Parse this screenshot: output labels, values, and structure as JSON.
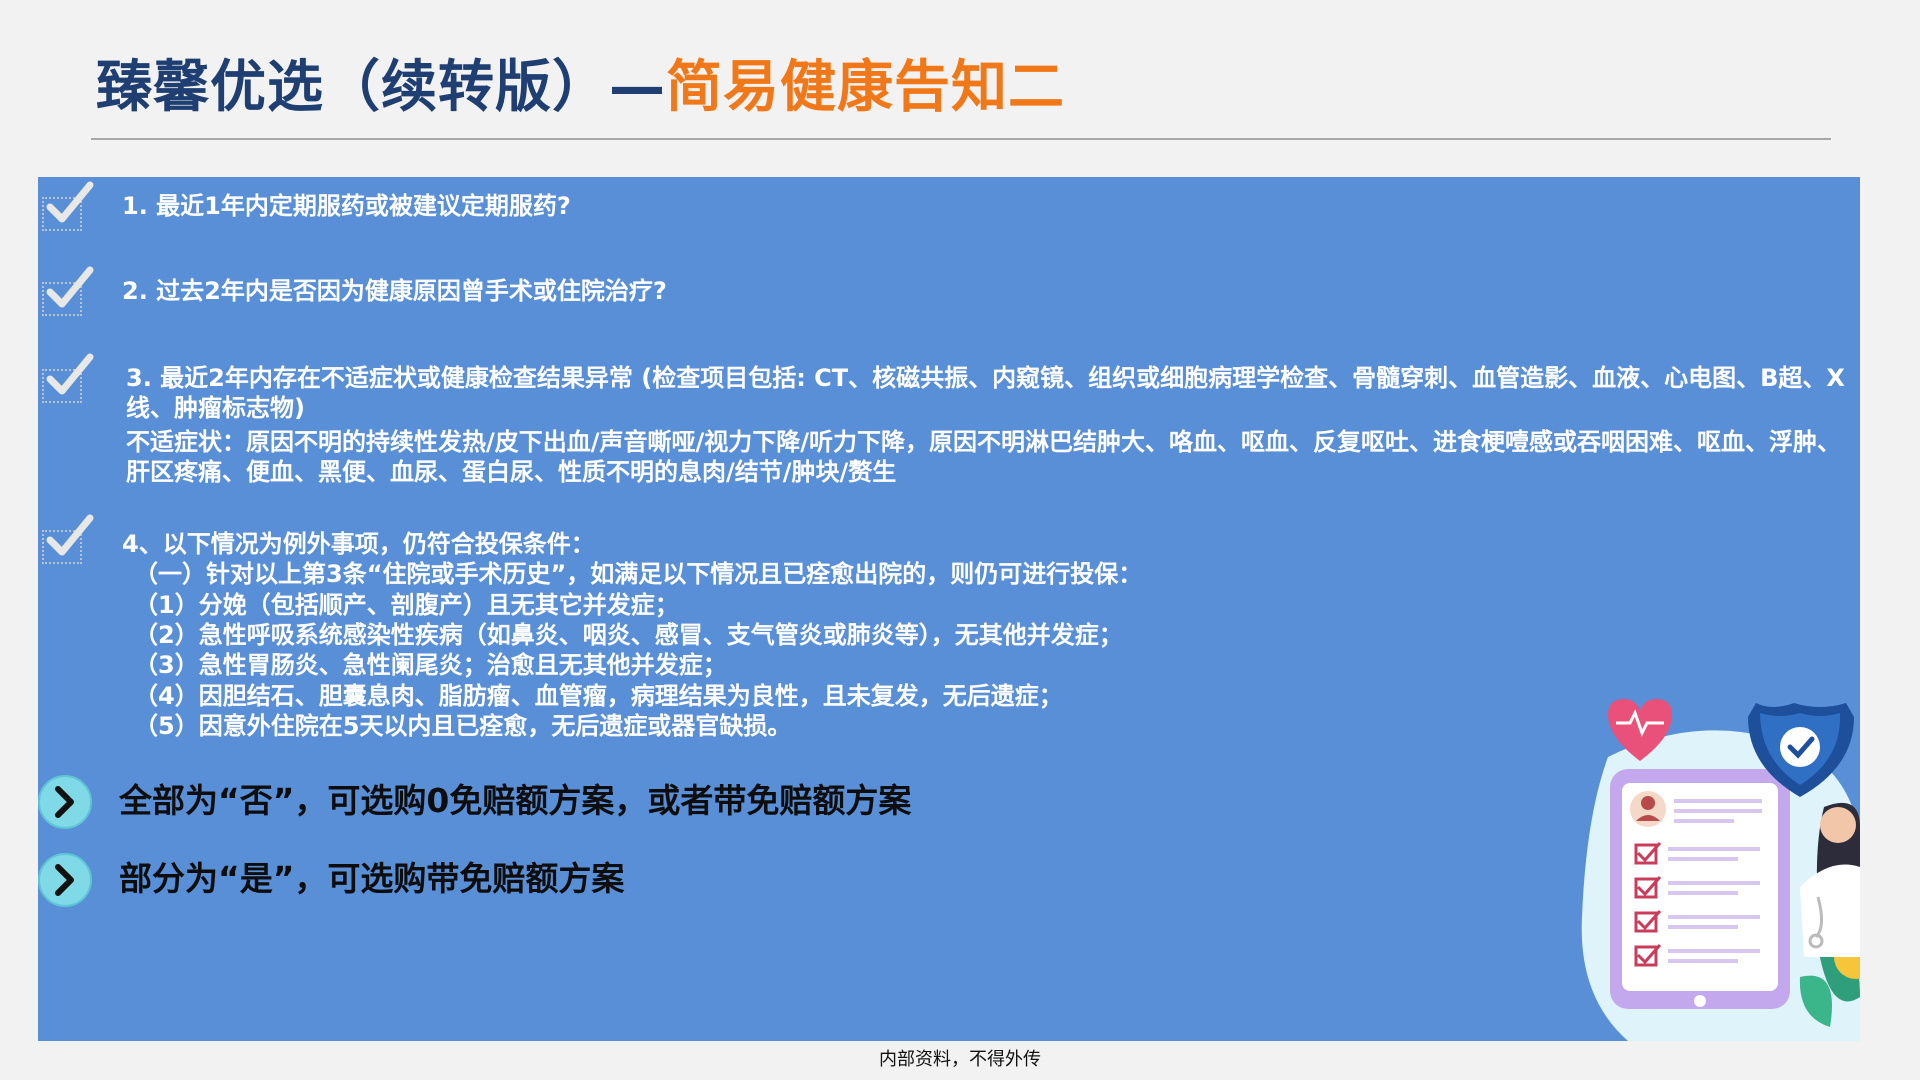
{
  "header": {
    "title_main": "臻馨优选（续转版）—",
    "title_accent": "简易健康告知二"
  },
  "questions": [
    "1. 最近1年内定期服药或被建议定期服药?",
    "2. 过去2年内是否因为健康原因曾手术或住院治疗?",
    {
      "line1": "3. 最近2年内存在不适症状或健康检查结果异常 (检查项目包括: CT、核磁共振、内窥镜、组织或细胞病理学检查、骨髓穿刺、血管造影、血液、心电图、B超、X线、肿瘤标志物)",
      "line2": "不适症状：原因不明的持续性发热/皮下出血/声音嘶哑/视力下降/听力下降，原因不明淋巴结肿大、咯血、呕血、反复呕吐、进食梗噎感或吞咽困难、呕血、浮肿、肝区疼痛、便血、黑便、血尿、蛋白尿、性质不明的息肉/结节/肿块/赘生"
    },
    {
      "lines": [
        "4、以下情况为例外事项，仍符合投保条件：",
        "（一）针对以上第3条“住院或手术历史”，如满足以下情况且已痊愈出院的，则仍可进行投保：",
        "（1）分娩（包括顺产、剖腹产）且无其它并发症；",
        "（2）急性呼吸系统感染性疾病（如鼻炎、咽炎、感冒、支气管炎或肺炎等），无其他并发症；",
        "（3）急性胃肠炎、急性阑尾炎；治愈且无其他并发症；",
        "（4）因胆结石、胆囊息肉、脂肪瘤、血管瘤，病理结果为良性，且未复发，无后遗症；",
        "（5）因意外住院在5天以内且已痊愈，无后遗症或器官缺损。"
      ]
    }
  ],
  "conclusions": [
    "全部为“否”，可选购0免赔额方案，或者带免赔额方案",
    "部分为“是”，可选购带免赔额方案"
  ],
  "footer": "内部资料，不得外传",
  "colors": {
    "panel": "#598fd6",
    "title_main": "#1f3f73",
    "title_accent": "#f07818",
    "arrow_circle": "#7fd9e6"
  },
  "icons": [
    "check-icon",
    "chevron-right-icon",
    "heart-pulse-icon",
    "shield-check-icon",
    "clipboard-icon",
    "doctor-icon"
  ]
}
